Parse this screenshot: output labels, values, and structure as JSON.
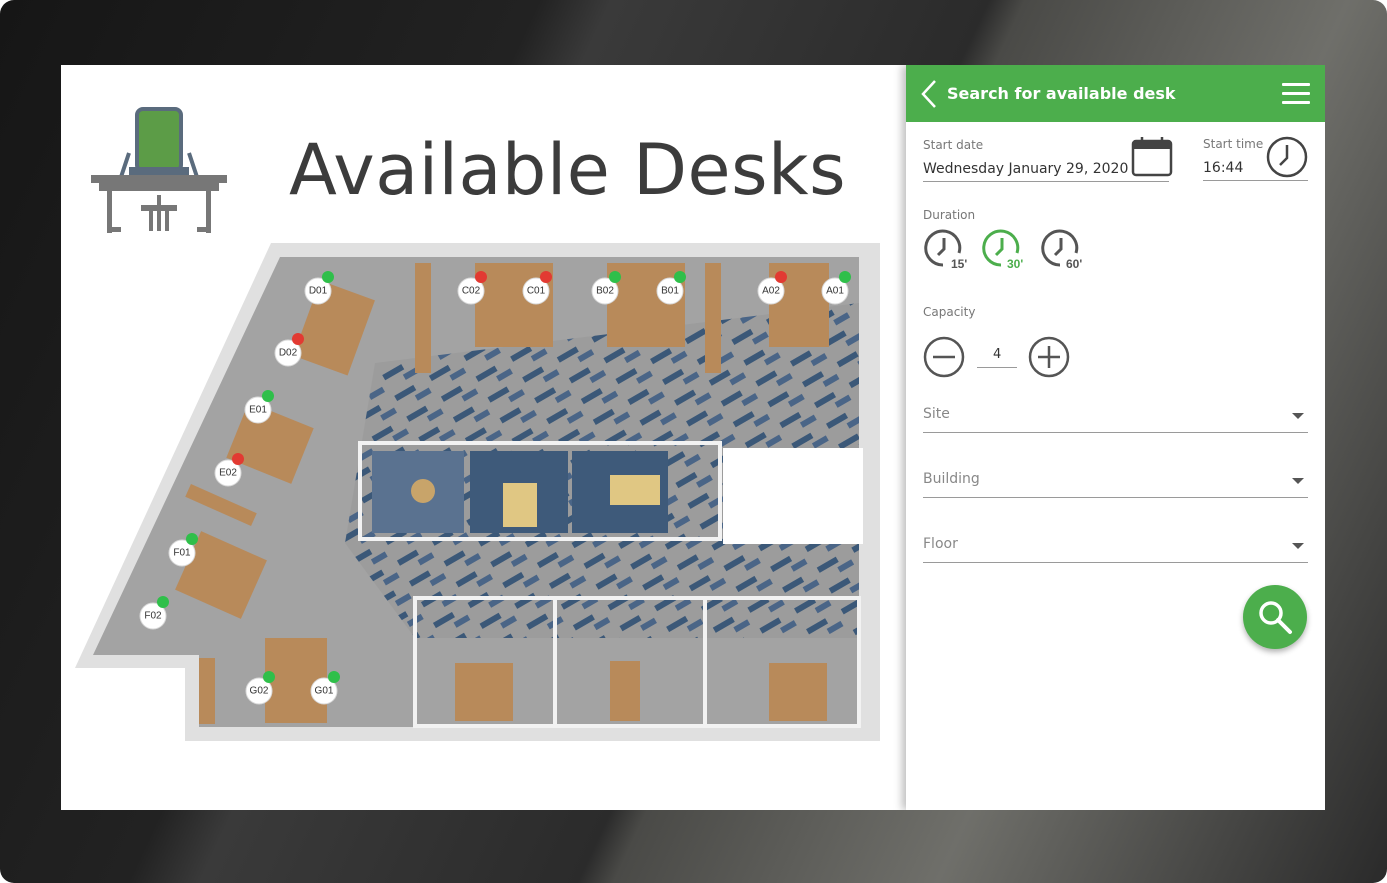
{
  "main": {
    "title": "Available Desks",
    "logo_icon": "desk-chair-icon"
  },
  "floor_plan": {
    "desks": [
      {
        "id": "D01",
        "status": "available"
      },
      {
        "id": "D02",
        "status": "occupied"
      },
      {
        "id": "C02",
        "status": "occupied"
      },
      {
        "id": "C01",
        "status": "occupied"
      },
      {
        "id": "B02",
        "status": "available"
      },
      {
        "id": "B01",
        "status": "available"
      },
      {
        "id": "A02",
        "status": "occupied"
      },
      {
        "id": "A01",
        "status": "available"
      },
      {
        "id": "E01",
        "status": "available"
      },
      {
        "id": "E02",
        "status": "occupied"
      },
      {
        "id": "F01",
        "status": "available"
      },
      {
        "id": "F02",
        "status": "available"
      },
      {
        "id": "G02",
        "status": "available"
      },
      {
        "id": "G01",
        "status": "available"
      }
    ],
    "status_colors": {
      "available": "#2fbf4a",
      "occupied": "#e23a32"
    }
  },
  "panel": {
    "header_title": "Search for available desk",
    "header_color": "#4cae4c",
    "back_icon": "chevron-left-icon",
    "menu_icon": "hamburger-menu-icon",
    "start_date": {
      "label": "Start date",
      "value": "Wednesday January 29, 2020",
      "icon": "calendar-icon"
    },
    "start_time": {
      "label": "Start time",
      "value": "16:44",
      "icon": "clock-icon"
    },
    "duration": {
      "label": "Duration",
      "options": [
        {
          "label": "15'",
          "selected": false
        },
        {
          "label": "30'",
          "selected": true
        },
        {
          "label": "60'",
          "selected": false
        }
      ]
    },
    "capacity": {
      "label": "Capacity",
      "value": "4",
      "decrement_icon": "minus-circle-icon",
      "increment_icon": "plus-circle-icon"
    },
    "site": {
      "label": "Site"
    },
    "building": {
      "label": "Building"
    },
    "floor": {
      "label": "Floor"
    },
    "search_icon": "search-icon"
  }
}
